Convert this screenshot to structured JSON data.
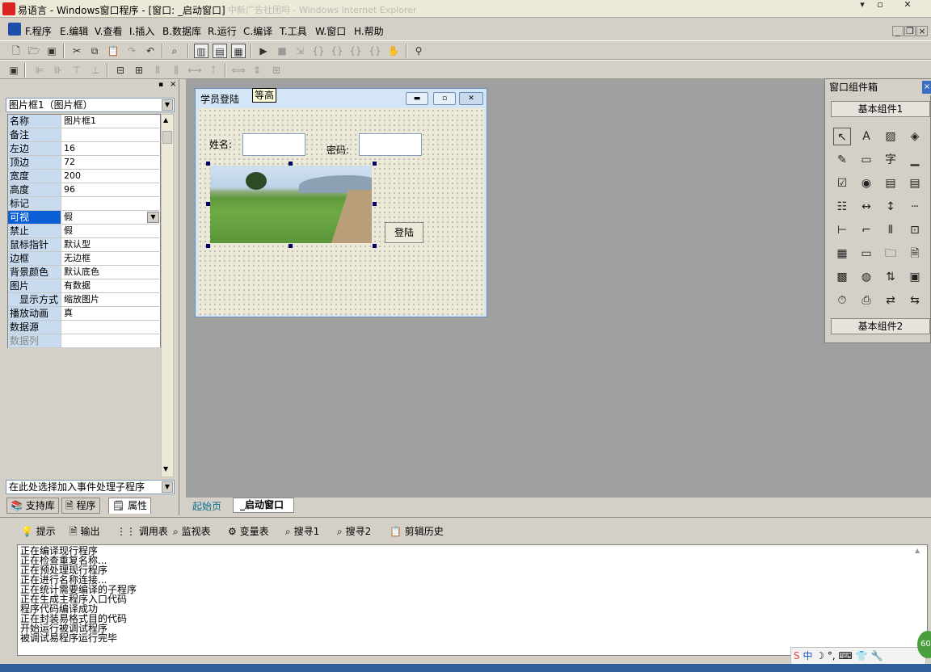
{
  "window": {
    "title": "易语言 - Windows窗口程序 - [窗口: _启动窗口]",
    "ghost_title": "中新广告社团吗 - Windows Internet Explorer",
    "min": "▾",
    "restore": "▫",
    "close": "✕"
  },
  "menu": [
    {
      "label": "F.程序"
    },
    {
      "label": "E.编辑"
    },
    {
      "label": "V.查看"
    },
    {
      "label": "I.插入"
    },
    {
      "label": "B.数据库"
    },
    {
      "label": "R.运行"
    },
    {
      "label": "C.编译"
    },
    {
      "label": "T.工具"
    },
    {
      "label": "W.窗口"
    },
    {
      "label": "H.帮助"
    }
  ],
  "mdi_controls": {
    "min": "_",
    "restore": "❐",
    "close": "×"
  },
  "properties": {
    "object_selector": "图片框1（图片框）",
    "rows": [
      {
        "name": "名称",
        "value": "图片框1"
      },
      {
        "name": "备注",
        "value": ""
      },
      {
        "name": "左边",
        "value": "16"
      },
      {
        "name": "顶边",
        "value": "72"
      },
      {
        "name": "宽度",
        "value": "200"
      },
      {
        "name": "高度",
        "value": "96"
      },
      {
        "name": "标记",
        "value": ""
      },
      {
        "name": "可视",
        "value": "假"
      },
      {
        "name": "禁止",
        "value": "假"
      },
      {
        "name": "鼠标指针",
        "value": "默认型"
      },
      {
        "name": "边框",
        "value": "无边框"
      },
      {
        "name": "背景颜色",
        "value": "默认底色"
      },
      {
        "name": "图片",
        "value": "有数据"
      },
      {
        "name": "显示方式",
        "value": "缩放图片"
      },
      {
        "name": "播放动画",
        "value": "真"
      },
      {
        "name": "数据源",
        "value": ""
      },
      {
        "name": "数据列",
        "value": ""
      }
    ],
    "event_selector": "在此处选择加入事件处理子程序",
    "tabs": [
      "支持库",
      "程序",
      "属性"
    ]
  },
  "form": {
    "title": "学员登陆",
    "name_label": "姓名:",
    "password_label": "密码:",
    "login_button": "登陆",
    "tooltip": "等高"
  },
  "toolbox": {
    "title": "窗口组件箱",
    "group1": "基本组件1",
    "group2": "基本组件2"
  },
  "doc_tabs": [
    "起始页",
    "_启动窗口"
  ],
  "bottom_tabs": [
    "提示",
    "输出",
    "调用表",
    "监视表",
    "变量表",
    "搜寻1",
    "搜寻2",
    "剪辑历史"
  ],
  "output_lines": [
    "正在编译现行程序",
    "正在检查重复名称...",
    "正在预处理现行程序",
    "正在进行名称连接...",
    "正在统计需要编译的子程序",
    "正在生成主程序入口代码",
    "程序代码编译成功",
    "正在封装易格式目的代码",
    "开始运行被调试程序",
    "被调试易程序运行完毕"
  ],
  "ime": {
    "label": "中"
  },
  "badge": "60"
}
